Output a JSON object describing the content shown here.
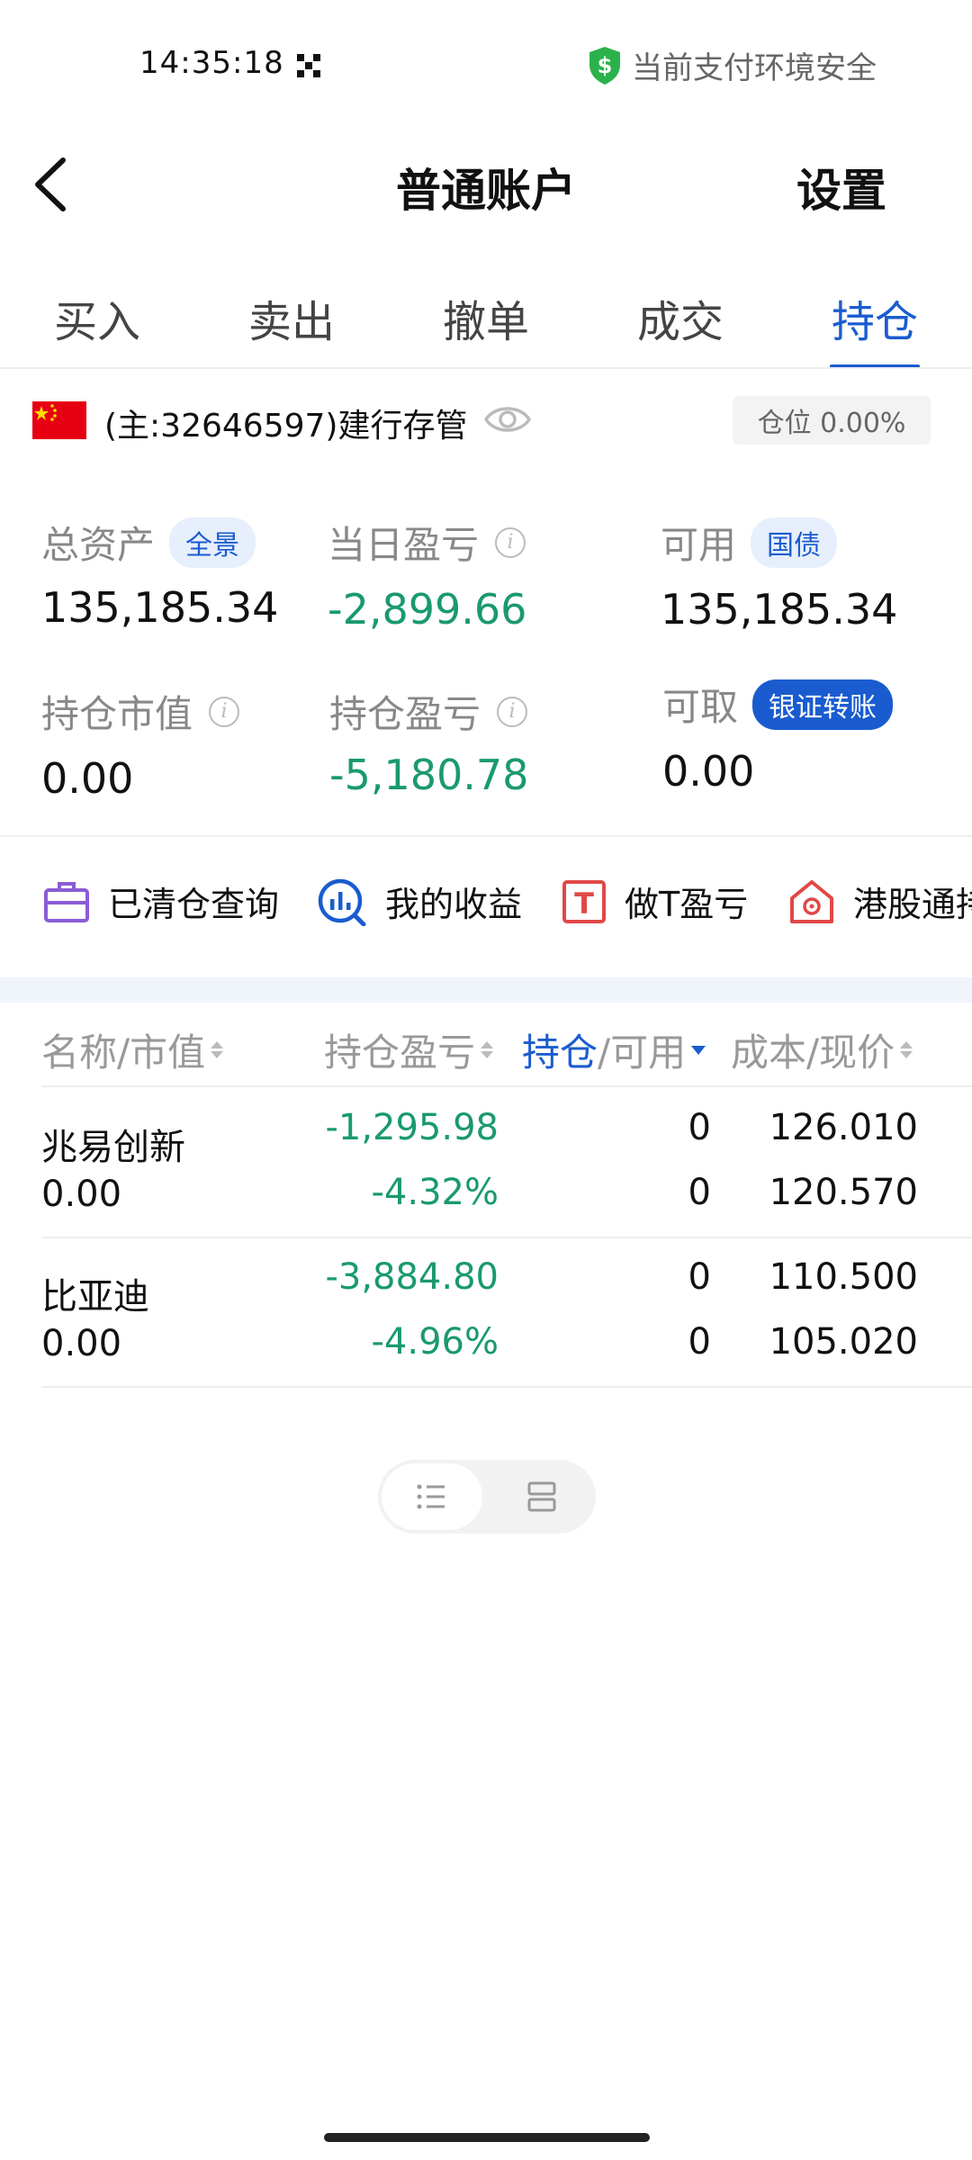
{
  "status_bar": {
    "time": "14:35:18",
    "secure_text": "当前支付环境安全"
  },
  "nav": {
    "title": "普通账户",
    "settings": "设置"
  },
  "tabs": [
    {
      "label": "买入"
    },
    {
      "label": "卖出"
    },
    {
      "label": "撤单"
    },
    {
      "label": "成交"
    },
    {
      "label": "持仓",
      "active": true
    }
  ],
  "account": {
    "label": "(主:32646597)建行存管",
    "position_ratio": "仓位 0.00%"
  },
  "metrics": {
    "total_assets": {
      "label": "总资产",
      "badge": "全景",
      "value": "135,185.34"
    },
    "daily_pnl": {
      "label": "当日盈亏",
      "value": "-2,899.66"
    },
    "available": {
      "label": "可用",
      "badge": "国债",
      "value": "135,185.34"
    },
    "holding_value": {
      "label": "持仓市值",
      "value": "0.00"
    },
    "holding_pnl": {
      "label": "持仓盈亏",
      "value": "-5,180.78"
    },
    "withdrawable": {
      "label": "可取",
      "badge": "银证转账",
      "value": "0.00"
    }
  },
  "shortcuts": [
    {
      "label": "已清仓查询",
      "icon": "briefcase-icon",
      "color": "#8a5cd6"
    },
    {
      "label": "我的收益",
      "icon": "chart-search-icon",
      "color": "#1a5ccf"
    },
    {
      "label": "做T盈亏",
      "icon": "t-box-icon",
      "color": "#e04848"
    },
    {
      "label": "港股通持",
      "icon": "hk-house-icon",
      "color": "#e04848"
    }
  ],
  "table": {
    "headers": {
      "name": "名称/市值",
      "pnl": "持仓盈亏",
      "hold": "持仓",
      "avail": "/可用",
      "cost": "成本/现价"
    },
    "rows": [
      {
        "name": "兆易创新",
        "market_value": "0.00",
        "pnl": "-1,295.98",
        "pnl_pct": "-4.32%",
        "hold": "0",
        "avail": "0",
        "cost": "126.010",
        "price": "120.570"
      },
      {
        "name": "比亚迪",
        "market_value": "0.00",
        "pnl": "-3,884.80",
        "pnl_pct": "-4.96%",
        "hold": "0",
        "avail": "0",
        "cost": "110.500",
        "price": "105.020"
      }
    ]
  },
  "colors": {
    "accent": "#1a5ccf",
    "down_green": "#1a9a6c",
    "secure_green": "#2bb24c"
  }
}
